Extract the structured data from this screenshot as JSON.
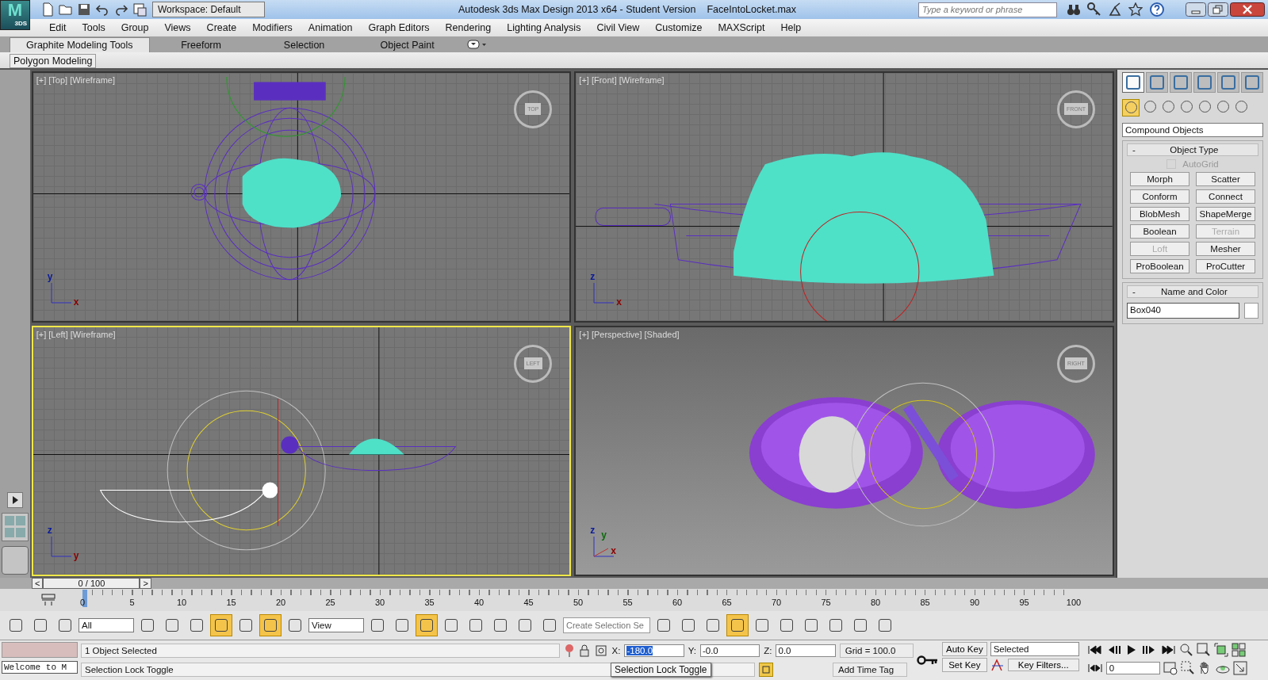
{
  "title_bar": {
    "logo_letter": "M",
    "logo_text": "3DS",
    "workspace": "Workspace: Default",
    "title": "Autodesk 3ds Max Design 2013 x64 - Student Version",
    "file_name": "FaceIntoLocket.max",
    "search": {
      "placeholder": "Type a keyword or phrase"
    }
  },
  "menu": [
    "Edit",
    "Tools",
    "Group",
    "Views",
    "Create",
    "Modifiers",
    "Animation",
    "Graph Editors",
    "Rendering",
    "Lighting Analysis",
    "Civil View",
    "Customize",
    "MAXScript",
    "Help"
  ],
  "ribbon_tabs": [
    {
      "label": "Graphite Modeling Tools",
      "selected": true
    },
    {
      "label": "Freeform",
      "selected": false
    },
    {
      "label": "Selection",
      "selected": false
    },
    {
      "label": "Object Paint",
      "selected": false
    }
  ],
  "ribbon_panel": "Polygon Modeling",
  "viewports": [
    {
      "kind": "top",
      "label": "[+] [Top] [Wireframe]",
      "cube_label": "TOP",
      "axes": [
        "y",
        "x"
      ],
      "selected": false
    },
    {
      "kind": "front",
      "label": "[+] [Front] [Wireframe]",
      "cube_label": "FRONT",
      "axes": [
        "z",
        "x"
      ],
      "selected": false
    },
    {
      "kind": "left",
      "label": "[+] [Left] [Wireframe]",
      "cube_label": "LEFT",
      "axes": [
        "z",
        "y"
      ],
      "selected": true
    },
    {
      "kind": "perspective",
      "label": "[+] [Perspective] [Shaded]",
      "cube_label": "RIGHT",
      "axes": [
        "z",
        "y",
        "x"
      ],
      "selected": false
    }
  ],
  "command_panel": {
    "tabs": [
      {
        "selected": true
      },
      {
        "selected": false
      },
      {
        "selected": false
      },
      {
        "selected": false
      },
      {
        "selected": false
      },
      {
        "selected": false
      }
    ],
    "categories": [
      {
        "selected": true
      },
      {
        "selected": false
      },
      {
        "selected": false
      },
      {
        "selected": false
      },
      {
        "selected": false
      },
      {
        "selected": false
      },
      {
        "selected": false
      }
    ],
    "dropdown": "Compound Objects",
    "object_type": {
      "title": "Object Type",
      "collapse": "-",
      "autogrid": {
        "label": "AutoGrid",
        "checked": false,
        "disabled": true
      },
      "buttons": [
        {
          "label": "Morph",
          "disabled": false
        },
        {
          "label": "Scatter",
          "disabled": false
        },
        {
          "label": "Conform",
          "disabled": false
        },
        {
          "label": "Connect",
          "disabled": false
        },
        {
          "label": "BlobMesh",
          "disabled": false
        },
        {
          "label": "ShapeMerge",
          "disabled": false
        },
        {
          "label": "Boolean",
          "disabled": false
        },
        {
          "label": "Terrain",
          "disabled": true
        },
        {
          "label": "Loft",
          "disabled": true
        },
        {
          "label": "Mesher",
          "disabled": false
        },
        {
          "label": "ProBoolean",
          "disabled": false
        },
        {
          "label": "ProCutter",
          "disabled": false
        }
      ]
    },
    "name_and_color": {
      "title": "Name and Color",
      "collapse": "-",
      "name": "Box040",
      "color": "#ffffff"
    }
  },
  "time_slider": {
    "prev": "<",
    "frame": "0 / 100",
    "next": ">"
  },
  "time_ruler": [
    "0",
    "5",
    "10",
    "15",
    "20",
    "25",
    "30",
    "35",
    "40",
    "45",
    "50",
    "55",
    "60",
    "65",
    "70",
    "75",
    "80",
    "85",
    "90",
    "95",
    "100"
  ],
  "main_toolbar": [
    {
      "kind": "icon",
      "selected": false
    },
    {
      "kind": "icon",
      "selected": false
    },
    {
      "kind": "icon",
      "selected": false
    },
    {
      "kind": "dropdown",
      "value": "All"
    },
    {
      "kind": "icon",
      "selected": false
    },
    {
      "kind": "icon",
      "selected": false
    },
    {
      "kind": "icon",
      "selected": false
    },
    {
      "kind": "icon",
      "selected": true
    },
    {
      "kind": "icon",
      "selected": false
    },
    {
      "kind": "icon",
      "selected": true
    },
    {
      "kind": "icon",
      "selected": false
    },
    {
      "kind": "dropdown",
      "value": "View"
    },
    {
      "kind": "icon",
      "selected": false
    },
    {
      "kind": "icon",
      "selected": false
    },
    {
      "kind": "icon",
      "selected": true
    },
    {
      "kind": "icon",
      "selected": false
    },
    {
      "kind": "icon",
      "selected": false
    },
    {
      "kind": "icon",
      "selected": false
    },
    {
      "kind": "icon",
      "selected": false
    },
    {
      "kind": "icon",
      "selected": false
    },
    {
      "kind": "field",
      "placeholder": "Create Selection Se"
    },
    {
      "kind": "icon",
      "selected": false
    },
    {
      "kind": "icon",
      "selected": false
    },
    {
      "kind": "icon",
      "selected": false
    },
    {
      "kind": "icon",
      "selected": true
    },
    {
      "kind": "icon",
      "selected": false
    },
    {
      "kind": "icon",
      "selected": false
    },
    {
      "kind": "icon",
      "selected": false
    },
    {
      "kind": "icon",
      "selected": false
    },
    {
      "kind": "icon",
      "selected": false
    },
    {
      "kind": "icon",
      "selected": false
    }
  ],
  "status_bar": {
    "listener": "Welcome to M",
    "selection": "1 Object Selected",
    "prompt": "Selection Lock Toggle",
    "coords": [
      {
        "label": "X:",
        "value": "-180.0",
        "highlighted": true
      },
      {
        "label": "Y:",
        "value": "-0.0",
        "highlighted": false
      },
      {
        "label": "Z:",
        "value": "0.0",
        "highlighted": false
      }
    ],
    "grid": "Grid = 100.0",
    "time_tag": "Add Time Tag",
    "auto_key": "Auto Key",
    "set_key": "Set Key",
    "key_mode": "Selected",
    "key_filters": "Key Filters...",
    "current_frame": "0"
  },
  "tooltip": "Selection Lock Toggle"
}
